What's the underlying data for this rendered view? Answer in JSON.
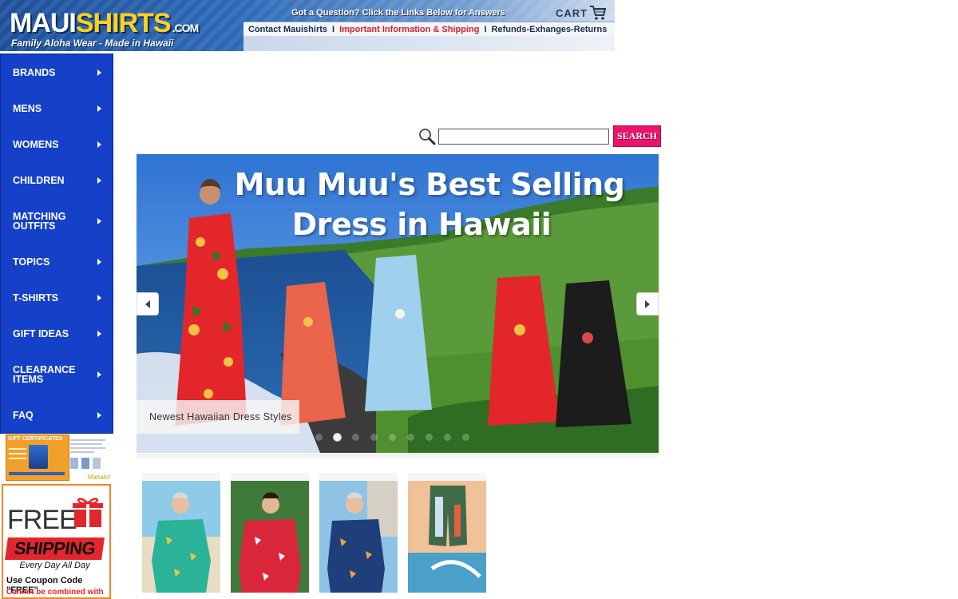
{
  "header": {
    "logo_main": "MAUI",
    "logo_accent": "SHIRTS",
    "logo_suffix": ".COM",
    "tagline": "Family Aloha Wear - Made in Hawaii",
    "question": "Got a Question?  Click the Links Below  for  Answers",
    "cart_label": "CART",
    "links": [
      {
        "label": "Contact Mauishirts"
      },
      {
        "label": "Important Information & Shipping"
      },
      {
        "label": "Refunds-Exhanges-Returns"
      }
    ],
    "separator": "I",
    "colors": {
      "brand_blue": "#1d4f9a",
      "accent_yellow": "#ffd21a",
      "link_red": "#d3232e"
    }
  },
  "sidebar": {
    "items": [
      {
        "label": "BRANDS"
      },
      {
        "label": "MENS"
      },
      {
        "label": "WOMENS"
      },
      {
        "label": "CHILDREN"
      },
      {
        "label": "MATCHING OUTFITS"
      },
      {
        "label": "TOPICS"
      },
      {
        "label": "T-SHIRTS"
      },
      {
        "label": "GIFT IDEAS"
      },
      {
        "label": "CLEARANCE ITEMS"
      },
      {
        "label": "FAQ"
      }
    ],
    "color": "#1540c8",
    "gift_certificates": {
      "title": "GIFT CERTIFICATES",
      "signoff": "Mahalo!"
    },
    "free_shipping": {
      "free": "FREE",
      "shipping": "SHIPPING",
      "every_day": "Every Day All Day",
      "coupon": "Use Coupon Code \"FREE\"",
      "note": "Cannot be combined with"
    }
  },
  "search": {
    "value": "",
    "button_label": "SEARCH",
    "button_color": "#e9156a"
  },
  "banner": {
    "headline_line1": "Muu Muu's Best Selling",
    "headline_line2": "Dress in Hawaii",
    "caption": "Newest Hawaiian Dress Styles",
    "slide_count": 9,
    "active_slide": 2
  },
  "products": [
    {
      "name": "men-aloha-shirt-teal-floral",
      "icon": "shirt-photo"
    },
    {
      "name": "men-aloha-shirt-red-floral",
      "icon": "shirt-photo"
    },
    {
      "name": "men-aloha-shirt-navy-floral",
      "icon": "shirt-photo"
    },
    {
      "name": "board-shorts-surf",
      "icon": "shorts-photo"
    }
  ]
}
